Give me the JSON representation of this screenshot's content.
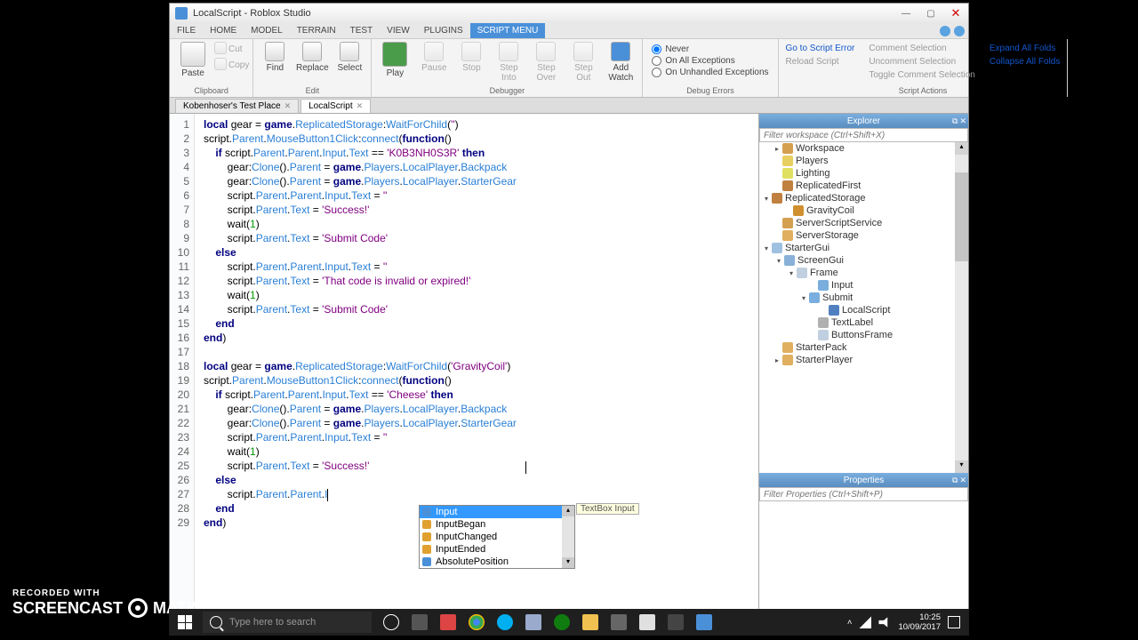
{
  "window": {
    "title": "LocalScript - Roblox Studio"
  },
  "menu": {
    "items": [
      "FILE",
      "HOME",
      "MODEL",
      "TERRAIN",
      "TEST",
      "VIEW",
      "PLUGINS",
      "SCRIPT MENU"
    ],
    "active": 7
  },
  "ribbon": {
    "clipboard": {
      "paste": "Paste",
      "cut": "Cut",
      "copy": "Copy",
      "label": "Clipboard"
    },
    "edit": {
      "find": "Find",
      "replace": "Replace",
      "select": "Select",
      "label": "Edit"
    },
    "debugger": {
      "play": "Play",
      "pause": "Pause",
      "stop": "Stop",
      "stepin": "Step\nInto",
      "stepover": "Step\nOver",
      "stepout": "Step\nOut",
      "addwatch": "Add\nWatch",
      "label": "Debugger"
    },
    "debugerrs": {
      "never": "Never",
      "allexc": "On All Exceptions",
      "unhandled": "On Unhandled Exceptions",
      "label": "Debug Errors"
    },
    "scriptactions": {
      "goto": "Go to Script Error",
      "reload": "Reload Script",
      "comment": "Comment Selection",
      "uncomment": "Uncomment Selection",
      "toggle": "Toggle Comment Selection",
      "expand": "Expand All Folds",
      "collapse": "Collapse All Folds",
      "label": "Script Actions"
    }
  },
  "tabs": {
    "t1": "Kobenhoser's Test Place",
    "t2": "LocalScript"
  },
  "explorer": {
    "title": "Explorer",
    "filter_ph": "Filter workspace (Ctrl+Shift+X)",
    "nodes": {
      "workspace": "Workspace",
      "players": "Players",
      "lighting": "Lighting",
      "repfirst": "ReplicatedFirst",
      "repstore": "ReplicatedStorage",
      "gravcoil": "GravityCoil",
      "sss": "ServerScriptService",
      "sstore": "ServerStorage",
      "startergui": "StarterGui",
      "screengui": "ScreenGui",
      "frame": "Frame",
      "input": "Input",
      "submit": "Submit",
      "localscript": "LocalScript",
      "textlabel": "TextLabel",
      "btnframe": "ButtonsFrame",
      "starterpack": "StarterPack",
      "starterplayer": "StarterPlayer"
    }
  },
  "properties": {
    "title": "Properties",
    "filter_ph": "Filter Properties (Ctrl+Shift+P)"
  },
  "code": {
    "lines": [
      "local gear = game.ReplicatedStorage:WaitForChild('')",
      "script.Parent.MouseButton1Click:connect(function()",
      "    if script.Parent.Parent.Input.Text == 'K0B3NH0S3R' then",
      "        gear:Clone().Parent = game.Players.LocalPlayer.Backpack",
      "        gear:Clone().Parent = game.Players.LocalPlayer.StarterGear",
      "        script.Parent.Parent.Input.Text = ''",
      "        script.Parent.Text = 'Success!'",
      "        wait(1)",
      "        script.Parent.Text = 'Submit Code'",
      "    else",
      "        script.Parent.Parent.Input.Text = ''",
      "        script.Parent.Text = 'That code is invalid or expired!'",
      "        wait(1)",
      "        script.Parent.Text = 'Submit Code'",
      "    end",
      "end)",
      "",
      "local gear = game.ReplicatedStorage:WaitForChild('GravityCoil')",
      "script.Parent.MouseButton1Click:connect(function()",
      "    if script.Parent.Parent.Input.Text == 'Cheese' then",
      "        gear:Clone().Parent = game.Players.LocalPlayer.Backpack",
      "        gear:Clone().Parent = game.Players.LocalPlayer.StarterGear",
      "        script.Parent.Parent.Input.Text = ''",
      "        wait(1)",
      "        script.Parent.Text = 'Success!'",
      "    else",
      "        script.Parent.Parent.I",
      "    end",
      "end)"
    ]
  },
  "autocomplete": {
    "items": {
      "i1": "Input",
      "i2": "InputBegan",
      "i3": "InputChanged",
      "i4": "InputEnded",
      "i5": "AbsolutePosition"
    },
    "tooltip": "TextBox Input"
  },
  "taskbar": {
    "search_ph": "Type here to search",
    "time": "10:25",
    "date": "10/09/2017"
  },
  "watermark": {
    "top": "RECORDED WITH",
    "brand1": "SCREENCAST",
    "brand2": "MATIC"
  }
}
